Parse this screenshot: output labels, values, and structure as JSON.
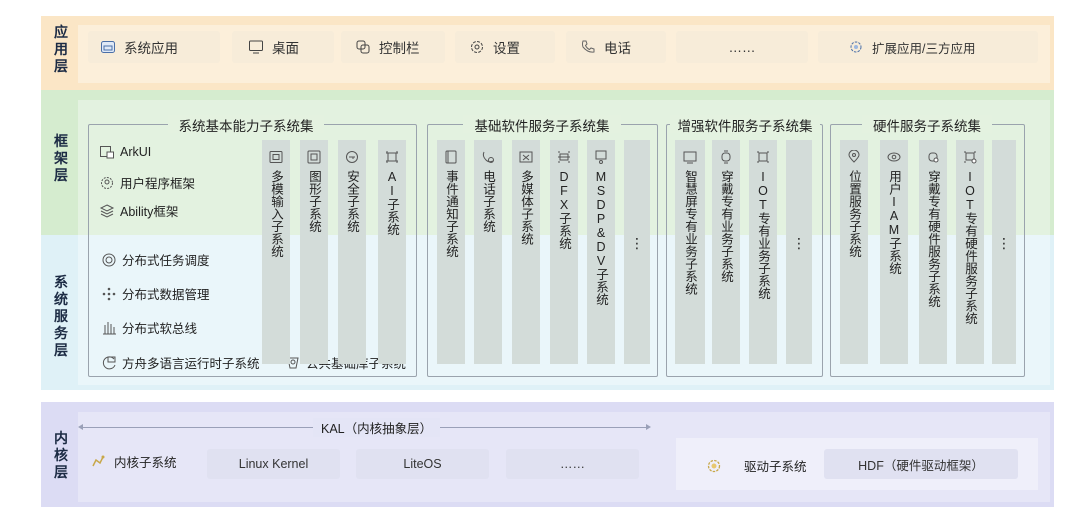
{
  "layers": {
    "app": {
      "label": [
        "应",
        "用",
        "层"
      ]
    },
    "framework": {
      "label": [
        "框",
        "架",
        "层"
      ]
    },
    "system_service": {
      "label": [
        "系",
        "统",
        "服",
        "务",
        "层"
      ]
    },
    "kernel": {
      "label": [
        "内",
        "核",
        "层"
      ]
    }
  },
  "app_layer": {
    "items": [
      {
        "label": "系统应用",
        "icon": "system-app-icon"
      },
      {
        "label": "桌面",
        "icon": "desktop-icon"
      },
      {
        "label": "控制栏",
        "icon": "control-bar-icon"
      },
      {
        "label": "设置",
        "icon": "settings-icon"
      },
      {
        "label": "电话",
        "icon": "phone-icon"
      },
      {
        "label": "……",
        "icon": ""
      }
    ],
    "extended": {
      "label": "扩展应用/三方应用",
      "icon": "extended-app-icon"
    }
  },
  "groups": {
    "basic": {
      "title": "系统基本能力子系统集",
      "framework_items": [
        {
          "label": "ArkUI",
          "icon": "arkui-icon"
        },
        {
          "label": "用户程序框架",
          "icon": "user-program-icon"
        },
        {
          "label": "Ability框架",
          "icon": "ability-icon"
        }
      ],
      "service_items": [
        {
          "label": "分布式任务调度",
          "icon": "task-schedule-icon"
        },
        {
          "label": "分布式数据管理",
          "icon": "data-manage-icon"
        },
        {
          "label": "分布式软总线",
          "icon": "soft-bus-icon"
        }
      ],
      "bottom_items": [
        {
          "label": "方舟多语言运行时子系统",
          "icon": "ark-runtime-icon"
        },
        {
          "label": "公共基础库子系统",
          "icon": "common-lib-icon"
        }
      ],
      "columns": [
        {
          "label": "多模输入子系统",
          "icon": "multimodal-input-icon"
        },
        {
          "label": "图形子系统",
          "icon": "graphics-icon"
        },
        {
          "label": "安全子系统",
          "icon": "security-icon"
        },
        {
          "label": "AI子系统",
          "icon": "ai-icon"
        }
      ]
    },
    "software": {
      "title": "基础软件服务子系统集",
      "columns": [
        {
          "label": "事件通知子系统",
          "icon": "event-notify-icon"
        },
        {
          "label": "电话子系统",
          "icon": "telephony-icon"
        },
        {
          "label": "多媒体子系统",
          "icon": "multimedia-icon"
        },
        {
          "label": "DFX子系统",
          "icon": "dfx-icon"
        },
        {
          "label": "MSDP&DV子系统",
          "icon": "msdp-icon"
        },
        {
          "label": "⋮",
          "icon": ""
        }
      ]
    },
    "enhanced": {
      "title": "增强软件服务子系统集",
      "columns": [
        {
          "label": "智慧屏专有业务子系统",
          "icon": "smart-screen-icon"
        },
        {
          "label": "穿戴专有业务子系统",
          "icon": "wearable-icon"
        },
        {
          "label": "IOT专有业务子系统",
          "icon": "iot-icon"
        },
        {
          "label": "⋮",
          "icon": ""
        }
      ]
    },
    "hardware": {
      "title": "硬件服务子系统集",
      "columns": [
        {
          "label": "位置服务子系统",
          "icon": "location-icon"
        },
        {
          "label": "用户IAM子系统",
          "icon": "user-iam-icon"
        },
        {
          "label": "穿戴专有硬件服务子系统",
          "icon": "wearable-hw-icon"
        },
        {
          "label": "IOT专有硬件服务子系统",
          "icon": "iot-hw-icon"
        },
        {
          "label": "⋮",
          "icon": ""
        }
      ]
    }
  },
  "kernel_layer": {
    "kal": "KAL（内核抽象层）",
    "kernel_subsystem": {
      "label": "内核子系统",
      "icon": "kernel-icon"
    },
    "kernels": [
      "Linux Kernel",
      "LiteOS",
      "……"
    ],
    "driver_subsystem": {
      "label": "驱动子系统",
      "icon": "driver-icon"
    },
    "hdf": "HDF（硬件驱动框架）"
  },
  "colors": {
    "app_band": "#fbe6c6",
    "framework_band": "#d5eccf",
    "service_band": "#dff1f7",
    "kernel_band": "#dcdcf4"
  }
}
